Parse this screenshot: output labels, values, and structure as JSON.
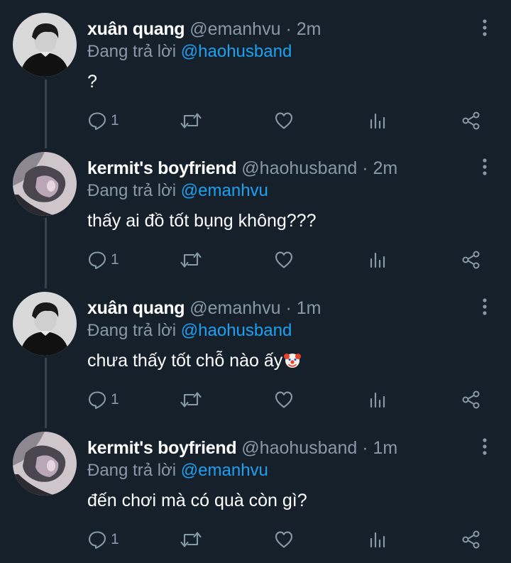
{
  "colors": {
    "background": "#15202b",
    "text_primary": "#ffffff",
    "text_secondary": "#8899a6",
    "link": "#1da1f2",
    "thread_line": "#38444d"
  },
  "icons": {
    "reply": "reply-icon",
    "retweet": "retweet-icon",
    "like": "heart-icon",
    "analytics": "analytics-icon",
    "share": "share-icon",
    "more": "more-vertical-icon",
    "emoji": "clown-face-emoji-icon"
  },
  "tweets": [
    {
      "author_name": "xuân quang",
      "author_handle": "@emanhvu",
      "separator": "·",
      "time": "2m",
      "replying_prefix": "Đang trả lời",
      "replying_to": "@haohusband",
      "text": "?",
      "reply_count": "1"
    },
    {
      "author_name": "kermit's boyfriend",
      "author_handle": "@haohusband",
      "separator": "·",
      "time": "2m",
      "replying_prefix": "Đang trả lời",
      "replying_to": "@emanhvu",
      "text": "thấy ai đồ tốt bụng không???",
      "reply_count": "1"
    },
    {
      "author_name": "xuân quang",
      "author_handle": "@emanhvu",
      "separator": "·",
      "time": "1m",
      "replying_prefix": "Đang trả lời",
      "replying_to": "@haohusband",
      "text": "chưa thấy tốt chỗ nào ấy",
      "reply_count": "1"
    },
    {
      "author_name": "kermit's boyfriend",
      "author_handle": "@haohusband",
      "separator": "·",
      "time": "1m",
      "replying_prefix": "Đang trả lời",
      "replying_to": "@emanhvu",
      "text": "đến chơi mà có quà còn gì?",
      "reply_count": "1"
    }
  ]
}
